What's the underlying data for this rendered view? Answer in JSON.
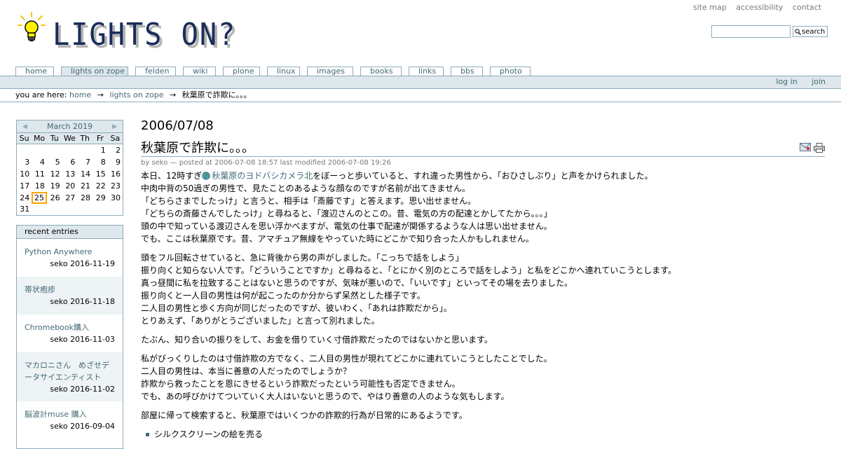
{
  "header": {
    "logo_text": "LIGHTS ON?",
    "site_actions": [
      "site map",
      "accessibility",
      "contact"
    ],
    "search_placeholder": "",
    "search_label": "search"
  },
  "tabs": [
    {
      "label": "home",
      "selected": false
    },
    {
      "label": "lights on zope",
      "selected": true
    },
    {
      "label": "felden",
      "selected": false
    },
    {
      "label": "wiki",
      "selected": false
    },
    {
      "label": "plone",
      "selected": false
    },
    {
      "label": "linux",
      "selected": false
    },
    {
      "label": "images",
      "selected": false
    },
    {
      "label": "books",
      "selected": false
    },
    {
      "label": "links",
      "selected": false
    },
    {
      "label": "bbs",
      "selected": false
    },
    {
      "label": "photo",
      "selected": false
    }
  ],
  "personal_bar": {
    "login": "log in",
    "join": "join"
  },
  "breadcrumb": {
    "prefix": "you are here:",
    "items": [
      "home",
      "lights on zope",
      "秋葉原で詐欺に。。。"
    ],
    "separator": "→"
  },
  "calendar": {
    "month": "March 2019",
    "weekdays": [
      "Su",
      "Mo",
      "Tu",
      "We",
      "Th",
      "Fr",
      "Sa"
    ],
    "weeks": [
      [
        "",
        "",
        "",
        "",
        "",
        "1",
        "2"
      ],
      [
        "3",
        "4",
        "5",
        "6",
        "7",
        "8",
        "9"
      ],
      [
        "10",
        "11",
        "12",
        "13",
        "14",
        "15",
        "16"
      ],
      [
        "17",
        "18",
        "19",
        "20",
        "21",
        "22",
        "23"
      ],
      [
        "24",
        "25",
        "26",
        "27",
        "28",
        "29",
        "30"
      ],
      [
        "31",
        "",
        "",
        "",
        "",
        "",
        ""
      ]
    ],
    "today": "25"
  },
  "recent": {
    "header": "recent entries",
    "entries": [
      {
        "title": "Python Anywhere",
        "meta": "seko 2016-11-19"
      },
      {
        "title": "帯状疱疹",
        "meta": "seko 2016-11-18"
      },
      {
        "title": "Chromebook購入",
        "meta": "seko 2016-11-03"
      },
      {
        "title": "マカロニさん　めざせデータサイエンティスト",
        "meta": "seko 2016-11-02"
      },
      {
        "title": "脳波計muse 購入",
        "meta": "seko 2016-09-04"
      }
    ]
  },
  "content": {
    "date": "2006/07/08",
    "title": "秋葉原で詐欺に。。。",
    "byline": "by seko — posted at 2006-07-08 18:57 last modified 2006-07-08 19:26",
    "first_line_before": "本日、12時すぎ",
    "first_line_link": "秋葉原のヨドバシカメラ北",
    "first_line_after": "をぼーっと歩いていると、すれ違った男性から、「おひさしぶり」と声をかけられました。",
    "para1_rest": [
      "中肉中背の50過ぎの男性で、見たことのあるような顔なのですが名前が出てきません。",
      "「どちらさまでしたっけ」と言うと、相手は「斎藤です」と答えます。思い出せません。",
      "「どちらの斎藤さんでしたっけ」と尋ねると、「渡辺さんのとこの。昔、電気の方の配達とかしてたから。。。」",
      "頭の中で知っている渡辺さんを思い浮かべますが、電気の仕事で配達が関係するような人は思い出せません。",
      "でも、ここは秋葉原です。昔、アマチュア無線をやっていた時にどこかで知り合った人かもしれません。"
    ],
    "para2": [
      "頭をフル回転させていると、急に背後から男の声がしました。「こっちで話をしよう」",
      "振り向くと知らない人です。「どういうことですか」と尋ねると、「とにかく別のところで話をしよう」と私をどこかへ連れていこうとします。",
      "真っ昼間に私を拉致することはないと思うのですが、気味が悪いので、「いいです」といってその場を去りました。",
      "振り向くと一人目の男性は何が起こったのか分からず呆然とした様子です。",
      "二人目の男性と歩く方向が同じだったのですが、彼いわく、「あれは詐欺だから」。",
      "とりあえず、「ありがとうございました」と言って別れました。"
    ],
    "para3": [
      "たぶん、知り合いの振りをして、お金を借りていく寸借詐欺だったのではないかと思います。"
    ],
    "para4": [
      "私がびっくりしたのは寸借詐欺の方でなく、二人目の男性が現れてどこかに連れていこうとしたことでした。",
      "二人目の男性は、本当に善意の人だったのでしょうか？",
      "詐欺から救ったことを恩にきせるという詐欺だったという可能性も否定できません。",
      "でも、あの呼びかけてついていく大人はいないと思うので、やはり善意の人のような気もします。"
    ],
    "para5": [
      "部屋に帰って検索すると、秋葉原ではいくつかの詐欺的行為が日常的にあるようです。"
    ],
    "list": [
      "シルクスクリーンの絵を売る"
    ]
  },
  "colors": {
    "border": "#8cacbb",
    "bar": "#dee7ec",
    "link": "#436976",
    "today_outline": "#ffa500",
    "logo_text": "#1a2d5a"
  },
  "icons": {
    "bulb": "lightbulb-icon",
    "search": "magnifier-icon",
    "mail": "mail-icon",
    "print": "print-icon",
    "globe": "globe-icon"
  }
}
